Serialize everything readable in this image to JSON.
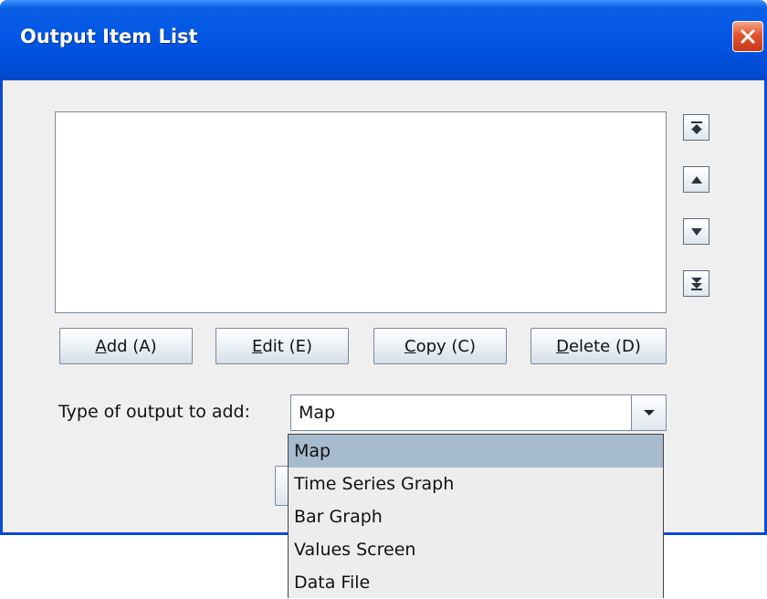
{
  "window": {
    "title": "Output Item List",
    "close_icon": "close-icon"
  },
  "reorder_buttons": [
    {
      "icon": "move-to-top-icon"
    },
    {
      "icon": "move-up-icon"
    },
    {
      "icon": "move-down-icon"
    },
    {
      "icon": "move-to-bottom-icon"
    }
  ],
  "actions": {
    "add": {
      "mnemonic": "A",
      "rest": "dd (A)"
    },
    "edit": {
      "mnemonic": "E",
      "rest": "dit (E)"
    },
    "copy": {
      "mnemonic": "C",
      "rest": "opy (C)"
    },
    "delete": {
      "mnemonic": "D",
      "rest": "elete (D)"
    }
  },
  "type_select": {
    "label": "Type of output to add:",
    "value": "Map",
    "options": [
      "Map",
      "Time Series Graph",
      "Bar Graph",
      "Values Screen",
      "Data File"
    ],
    "selected_index": 0
  },
  "colors": {
    "titlebar": "#0054e3",
    "selection": "#a7bbcf",
    "close_button": "#e2542c"
  }
}
